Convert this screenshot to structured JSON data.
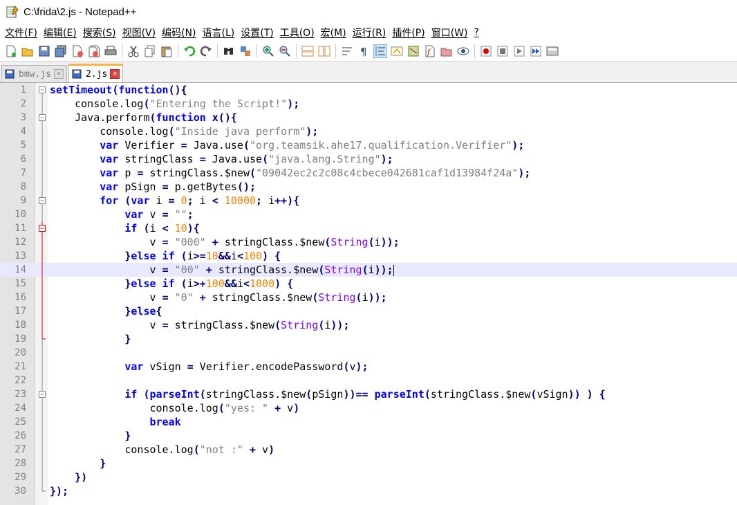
{
  "window": {
    "title": "C:\\frida\\2.js - Notepad++"
  },
  "menu": [
    "文件(F)",
    "编辑(E)",
    "搜索(S)",
    "视图(V)",
    "编码(N)",
    "语言(L)",
    "设置(T)",
    "工具(O)",
    "宏(M)",
    "运行(R)",
    "插件(P)",
    "窗口(W)",
    "?"
  ],
  "tabs": [
    {
      "label": "bmw.js",
      "active": false
    },
    {
      "label": "2.js",
      "active": true
    }
  ],
  "editor": {
    "current_line": 14,
    "lines": [
      [
        [
          "kw",
          "setTimeout"
        ],
        [
          "op",
          "("
        ],
        [
          "kw",
          "function"
        ],
        [
          "op",
          "(){"
        ]
      ],
      [
        [
          "",
          "    console.log"
        ],
        [
          "op",
          "("
        ],
        [
          "str",
          "\"Entering the Script!\""
        ],
        [
          "op",
          ");"
        ]
      ],
      [
        [
          "",
          "    Java.perform"
        ],
        [
          "op",
          "("
        ],
        [
          "kw",
          "function"
        ],
        [
          "",
          ""
        ],
        [
          "op",
          " x(){"
        ]
      ],
      [
        [
          "",
          "        console.log"
        ],
        [
          "op",
          "("
        ],
        [
          "str",
          "\"Inside java perform\""
        ],
        [
          "op",
          ");"
        ]
      ],
      [
        [
          "kw",
          "        var"
        ],
        [
          "",
          " Verifier "
        ],
        [
          "op",
          "="
        ],
        [
          "",
          " Java.use"
        ],
        [
          "op",
          "("
        ],
        [
          "str",
          "\"org.teamsik.ahe17.qualification.Verifier\""
        ],
        [
          "op",
          ");"
        ]
      ],
      [
        [
          "kw",
          "        var"
        ],
        [
          "",
          " stringClass "
        ],
        [
          "op",
          "="
        ],
        [
          "",
          " Java.use"
        ],
        [
          "op",
          "("
        ],
        [
          "str",
          "\"java.lang.String\""
        ],
        [
          "op",
          ");"
        ]
      ],
      [
        [
          "kw",
          "        var"
        ],
        [
          "",
          " p "
        ],
        [
          "op",
          "="
        ],
        [
          "",
          " stringClass.$new"
        ],
        [
          "op",
          "("
        ],
        [
          "str",
          "\"09042ec2c2c08c4cbece042681caf1d13984f24a\""
        ],
        [
          "op",
          ");"
        ]
      ],
      [
        [
          "kw",
          "        var"
        ],
        [
          "",
          " pSign "
        ],
        [
          "op",
          "="
        ],
        [
          "",
          " p.getBytes"
        ],
        [
          "op",
          "();"
        ]
      ],
      [
        [
          "kw",
          "        for"
        ],
        [
          "op",
          " ("
        ],
        [
          "kw",
          "var"
        ],
        [
          "",
          " i "
        ],
        [
          "op",
          "="
        ],
        [
          "num",
          " 0"
        ],
        [
          "op",
          ";"
        ],
        [
          "",
          " i "
        ],
        [
          "op",
          "<"
        ],
        [
          "num",
          " 10000"
        ],
        [
          "op",
          ";"
        ],
        [
          "",
          " i"
        ],
        [
          "op",
          "++){"
        ]
      ],
      [
        [
          "kw",
          "            var"
        ],
        [
          "",
          " v "
        ],
        [
          "op",
          "="
        ],
        [
          "str",
          " \"\""
        ],
        [
          "op",
          ";"
        ]
      ],
      [
        [
          "kw",
          "            if"
        ],
        [
          "op",
          " ("
        ],
        [
          "",
          "i "
        ],
        [
          "op",
          "<"
        ],
        [
          "num",
          " 10"
        ],
        [
          "op",
          "){"
        ]
      ],
      [
        [
          "",
          "                v "
        ],
        [
          "op",
          "="
        ],
        [
          "str",
          " \"000\""
        ],
        [
          "op",
          " +"
        ],
        [
          "",
          " stringClass.$new"
        ],
        [
          "op",
          "("
        ],
        [
          "fn",
          "String"
        ],
        [
          "op",
          "("
        ],
        [
          "",
          "i"
        ],
        [
          "op",
          "));"
        ]
      ],
      [
        [
          "op",
          "            }"
        ],
        [
          "kw",
          "else"
        ],
        [
          "kw",
          " if"
        ],
        [
          "op",
          " ("
        ],
        [
          "",
          "i"
        ],
        [
          "op",
          ">="
        ],
        [
          "num",
          "10"
        ],
        [
          "op",
          "&&"
        ],
        [
          "",
          "i"
        ],
        [
          "op",
          "<"
        ],
        [
          "num",
          "100"
        ],
        [
          "op",
          ")"
        ],
        [
          "op",
          " {"
        ]
      ],
      [
        [
          "",
          "                v "
        ],
        [
          "op",
          "="
        ],
        [
          "str",
          " \"00\""
        ],
        [
          "op",
          " +"
        ],
        [
          "",
          " stringClass.$new"
        ],
        [
          "op",
          "("
        ],
        [
          "fn",
          "String"
        ],
        [
          "op",
          "("
        ],
        [
          "",
          "i"
        ],
        [
          "op",
          "));"
        ]
      ],
      [
        [
          "op",
          "            }"
        ],
        [
          "kw",
          "else"
        ],
        [
          "kw",
          " if"
        ],
        [
          "op",
          " ("
        ],
        [
          "",
          "i"
        ],
        [
          "op",
          ">+"
        ],
        [
          "num",
          "100"
        ],
        [
          "op",
          "&&"
        ],
        [
          "",
          "i"
        ],
        [
          "op",
          "<"
        ],
        [
          "num",
          "1000"
        ],
        [
          "op",
          ")"
        ],
        [
          "op",
          " {"
        ]
      ],
      [
        [
          "",
          "                v "
        ],
        [
          "op",
          "="
        ],
        [
          "str",
          " \"0\""
        ],
        [
          "op",
          " +"
        ],
        [
          "",
          " stringClass.$new"
        ],
        [
          "op",
          "("
        ],
        [
          "fn",
          "String"
        ],
        [
          "op",
          "("
        ],
        [
          "",
          "i"
        ],
        [
          "op",
          "));"
        ]
      ],
      [
        [
          "op",
          "            }"
        ],
        [
          "kw",
          "else"
        ],
        [
          "op",
          "{"
        ]
      ],
      [
        [
          "",
          "                v "
        ],
        [
          "op",
          "="
        ],
        [
          "",
          " stringClass.$new"
        ],
        [
          "op",
          "("
        ],
        [
          "fn",
          "String"
        ],
        [
          "op",
          "("
        ],
        [
          "",
          "i"
        ],
        [
          "op",
          "));"
        ]
      ],
      [
        [
          "op",
          "            }"
        ]
      ],
      [
        [
          "",
          ""
        ]
      ],
      [
        [
          "kw",
          "            var"
        ],
        [
          "",
          " vSign "
        ],
        [
          "op",
          "="
        ],
        [
          "",
          " Verifier.encodePassword"
        ],
        [
          "op",
          "("
        ],
        [
          "",
          "v"
        ],
        [
          "op",
          ");"
        ]
      ],
      [
        [
          "",
          ""
        ]
      ],
      [
        [
          "kw",
          "            if"
        ],
        [
          "op",
          " ("
        ],
        [
          "kw",
          "parseInt"
        ],
        [
          "op",
          "("
        ],
        [
          "",
          "stringClass.$new"
        ],
        [
          "op",
          "("
        ],
        [
          "",
          "pSign"
        ],
        [
          "op",
          "))=="
        ],
        [
          "kw",
          " parseInt"
        ],
        [
          "op",
          "("
        ],
        [
          "",
          "stringClass.$new"
        ],
        [
          "op",
          "("
        ],
        [
          "",
          "vSign"
        ],
        [
          "op",
          "))"
        ],
        [
          "op",
          " )"
        ],
        [
          "op",
          " {"
        ]
      ],
      [
        [
          "",
          "                console.log"
        ],
        [
          "op",
          "("
        ],
        [
          "str",
          "\"yes: \""
        ],
        [
          "op",
          " +"
        ],
        [
          "",
          " v"
        ],
        [
          "op",
          ")"
        ]
      ],
      [
        [
          "kw",
          "                break"
        ]
      ],
      [
        [
          "op",
          "            }"
        ]
      ],
      [
        [
          "",
          "            console.log"
        ],
        [
          "op",
          "("
        ],
        [
          "str",
          "\"not :\""
        ],
        [
          "op",
          " +"
        ],
        [
          "",
          " v"
        ],
        [
          "op",
          ")"
        ]
      ],
      [
        [
          "op",
          "        }"
        ]
      ],
      [
        [
          "op",
          "    })"
        ]
      ],
      [
        [
          "op",
          "});"
        ]
      ]
    ]
  }
}
